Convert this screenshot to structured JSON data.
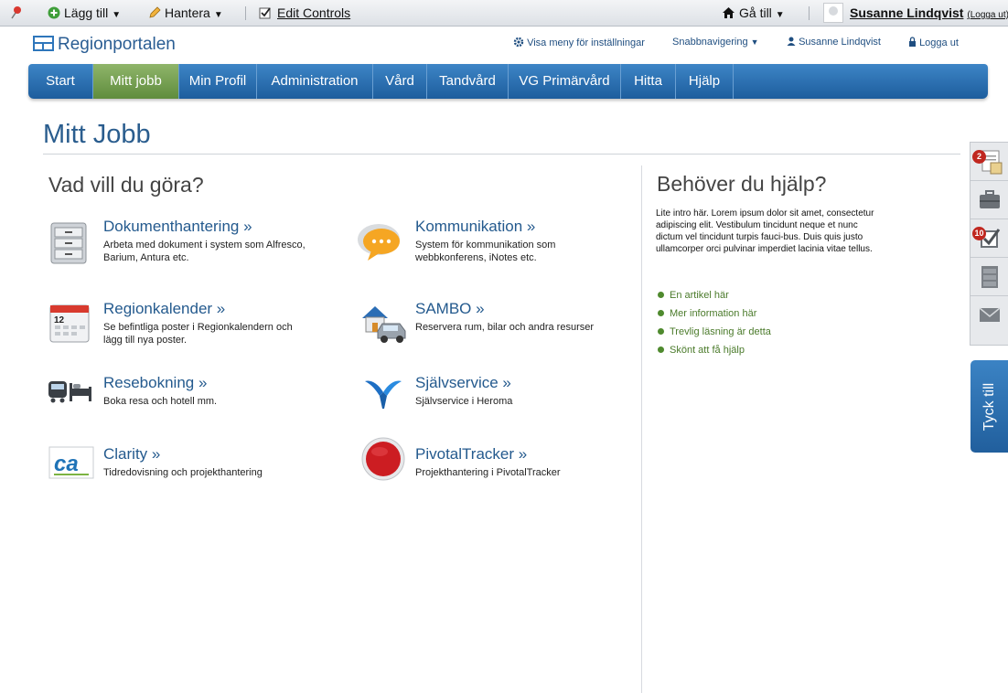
{
  "ribbon": {
    "add_label": "Lägg till",
    "manage_label": "Hantera",
    "edit_controls_label": "Edit Controls",
    "goto_label": "Gå till",
    "user_name": "Susanne Lindqvist",
    "logout_small": "(Logga ut)"
  },
  "header": {
    "logo_text": "Regionportalen",
    "settings_menu": "Visa meny för inställningar",
    "quick_nav": "Snabbnavigering",
    "user": "Susanne Lindqvist",
    "logout": "Logga ut"
  },
  "nav": {
    "tabs": [
      "Start",
      "Mitt jobb",
      "Min Profil",
      "Administration",
      "Vård",
      "Tandvård",
      "VG Primärvård",
      "Hitta",
      "Hjälp"
    ],
    "active": "Mitt jobb"
  },
  "page": {
    "title": "Mitt Jobb",
    "section_heading": "Vad vill du göra?"
  },
  "tiles": [
    {
      "title": "Dokumenthantering »",
      "desc": "Arbeta med dokument i system som Alfresco, Barium, Antura etc.",
      "icon": "cabinet-icon"
    },
    {
      "title": "Kommunikation »",
      "desc": "System för kommunikation som webbkonferens, iNotes etc.",
      "icon": "speech-bubble-icon"
    },
    {
      "title": "Regionkalender »",
      "desc": "Se befintliga poster i Regionkalendern och lägg till nya poster.",
      "icon": "calendar-icon",
      "calendar_day": "12"
    },
    {
      "title": "SAMBO »",
      "desc": "Reservera rum, bilar och andra resurser",
      "icon": "house-car-icon"
    },
    {
      "title": "Resebokning »",
      "desc": "Boka resa och hotell mm.",
      "icon": "train-bed-icon"
    },
    {
      "title": "Självservice »",
      "desc": "Självservice i Heroma",
      "icon": "bird-logo-icon"
    },
    {
      "title": "Clarity »",
      "desc": "Tidredovisning och projekthantering",
      "icon": "clarity-logo-icon",
      "logo_text": "ca"
    },
    {
      "title": "PivotalTracker »",
      "desc": "Projekthantering i PivotalTracker",
      "icon": "red-circle-icon"
    }
  ],
  "help": {
    "heading": "Behöver du hjälp?",
    "intro": "Lite intro här. Lorem ipsum dolor sit amet, consectetur adipiscing elit. Vestibulum tincidunt neque et nunc dictum vel tincidunt turpis fauci-bus. Duis quis justo ullamcorper orci pulvinar imperdiet lacinia vitae tellus.",
    "links": [
      "En artikel här",
      "Mer information här",
      "Trevlig läsning är detta",
      "Skönt att få hjälp"
    ]
  },
  "dock": {
    "items": [
      {
        "icon": "documents-icon",
        "badge": "2"
      },
      {
        "icon": "briefcase-icon",
        "badge": ""
      },
      {
        "icon": "checklist-icon",
        "badge": "10"
      },
      {
        "icon": "cabinet-icon",
        "badge": ""
      },
      {
        "icon": "envelope-icon",
        "badge": ""
      }
    ],
    "feedback_label": "Tyck till"
  },
  "colors": {
    "brand_blue": "#2a5d93",
    "nav_active_green": "#6f9a4c",
    "badge_red": "#c0271f",
    "link_green": "#4a7a2a"
  }
}
